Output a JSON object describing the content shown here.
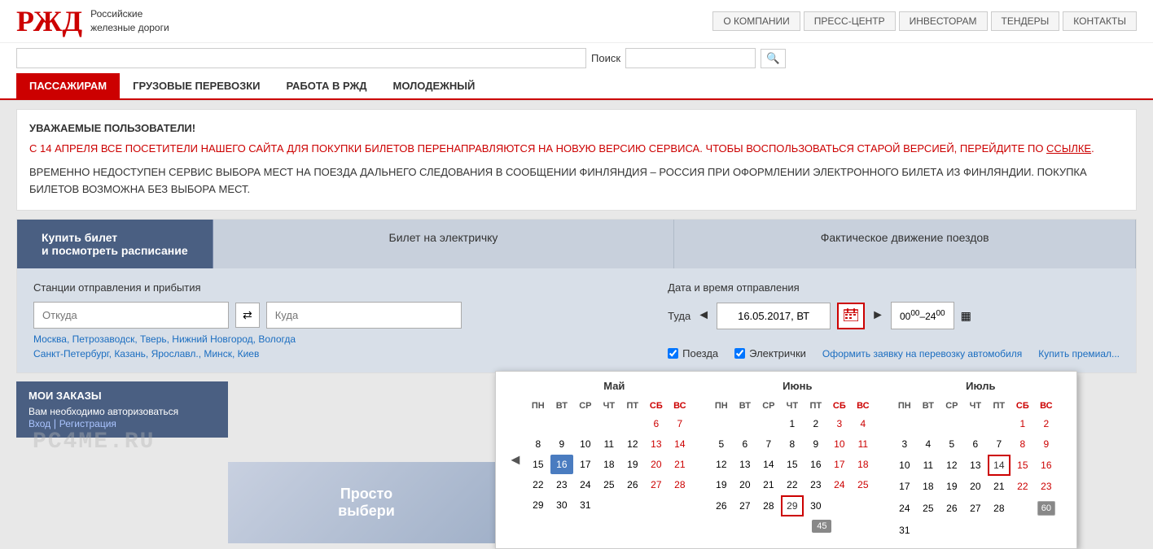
{
  "header": {
    "logo_text_line1": "Российские",
    "logo_text_line2": "железные дороги",
    "logo_symbol": "РЖД",
    "top_nav": [
      {
        "label": "О КОМПАНИИ"
      },
      {
        "label": "ПРЕСС-ЦЕНТР"
      },
      {
        "label": "ИНВЕСТОРАМ"
      },
      {
        "label": "ТЕНДЕРЫ"
      },
      {
        "label": "КОНТАКТЫ"
      }
    ],
    "search_label": "Поиск",
    "main_nav": [
      {
        "label": "ПАССАЖИРАМ",
        "active": true
      },
      {
        "label": "ГРУЗОВЫЕ ПЕРЕВОЗКИ",
        "active": false
      },
      {
        "label": "РАБОТА В РЖД",
        "active": false
      },
      {
        "label": "МОЛОДЕЖНЫЙ",
        "active": false
      }
    ]
  },
  "notice": {
    "title": "УВАЖАЕМЫЕ ПОЛЬЗОВАТЕЛИ!",
    "text1": "С 14 АПРЕЛЯ ВСЕ ПОСЕТИТЕЛИ НАШЕГО САЙТА ДЛЯ ПОКУПКИ БИЛЕТОВ ПЕРЕНАПРАВЛЯЮТСЯ НА НОВУЮ ВЕРСИЮ СЕРВИСА. ЧТОБЫ ВОСПОЛЬЗОВАТЬСЯ СТАРОЙ ВЕРСИЕЙ, ПЕРЕЙДИТЕ ПО ",
    "link": "ССЫЛКЕ",
    "text2": ".",
    "text3": "ВРЕМЕННО НЕДОСТУПЕН СЕРВИС ВЫБОРА МЕСТ НА ПОЕЗДА ДАЛЬНЕГО СЛЕДОВАНИЯ В СООБЩЕНИИ ФИНЛЯНДИЯ – РОССИЯ ПРИ ОФОРМЛЕНИИ ЭЛЕКТРОННОГО БИЛЕТА ИЗ ФИНЛЯНДИИ. ПОКУПКА БИЛЕТОВ ВОЗМОЖНА БЕЗ ВЫБОРА МЕСТ."
  },
  "tabs": [
    {
      "label": "Купить билет\nи посмотреть расписание",
      "active": true
    },
    {
      "label": "Билет на электричку",
      "active": false
    },
    {
      "label": "Фактическое движение поездов",
      "active": false
    }
  ],
  "form": {
    "stations_label": "Станции отправления и прибытия",
    "from_placeholder": "Откуда",
    "to_placeholder": "Куда",
    "from_suggestions": "Москва, Петрозаводск, Тверь, Нижний Новгород, Вологда",
    "to_suggestions": "Санкт-Петербург, Казань, Ярославл., Минск, Киев",
    "datetime_label": "Дата и время отправления",
    "direction_label": "Туда",
    "date_value": "16.05.2017, ВТ",
    "time_value": "00⁰⁰–24⁰⁰",
    "checkbox_train": "Поезда",
    "checkbox_elektr": "Электрички",
    "link1": "Оформить заявку на перевозку автомобиля",
    "link2": "Купить премиал..."
  },
  "my_orders": {
    "title": "МОИ ЗАКАЗЫ",
    "text": "Вам необходимо авторизоваться",
    "link_login": "Вход",
    "link_register": "Регистрация"
  },
  "calendar": {
    "months": [
      {
        "name": "Май",
        "headers": [
          "ПН",
          "ВТ",
          "СР",
          "ЧТ",
          "ПТ",
          "СБ",
          "ВС"
        ],
        "days": [
          {
            "d": "",
            "e": true
          },
          {
            "d": "",
            "e": true
          },
          {
            "d": "",
            "e": true
          },
          {
            "d": "",
            "e": true
          },
          {
            "d": "",
            "e": true
          },
          {
            "d": "6",
            "w": true
          },
          {
            "d": "7",
            "w": true
          },
          {
            "d": "8"
          },
          {
            "d": "9"
          },
          {
            "d": "10"
          },
          {
            "d": "11"
          },
          {
            "d": "12"
          },
          {
            "d": "13",
            "w": true
          },
          {
            "d": "14",
            "w": true
          },
          {
            "d": "15"
          },
          {
            "d": "16",
            "today": true
          },
          {
            "d": "17"
          },
          {
            "d": "18"
          },
          {
            "d": "19"
          },
          {
            "d": "20",
            "w": true
          },
          {
            "d": "21",
            "w": true
          },
          {
            "d": "22"
          },
          {
            "d": "23"
          },
          {
            "d": "24"
          },
          {
            "d": "25"
          },
          {
            "d": "26"
          },
          {
            "d": "27",
            "w": true
          },
          {
            "d": "28",
            "w": true
          },
          {
            "d": "29"
          },
          {
            "d": "30"
          },
          {
            "d": "31"
          },
          {
            "d": "",
            "e": true
          },
          {
            "d": "",
            "e": true
          },
          {
            "d": "",
            "e": true
          },
          {
            "d": "",
            "e": true
          }
        ]
      },
      {
        "name": "Июнь",
        "headers": [
          "ПН",
          "ВТ",
          "СР",
          "ЧТ",
          "ПТ",
          "СБ",
          "ВС"
        ],
        "days": [
          {
            "d": "",
            "e": true
          },
          {
            "d": "",
            "e": true
          },
          {
            "d": "",
            "e": true
          },
          {
            "d": "1"
          },
          {
            "d": "2"
          },
          {
            "d": "3",
            "w": true
          },
          {
            "d": "4",
            "w": true
          },
          {
            "d": "5"
          },
          {
            "d": "6"
          },
          {
            "d": "7"
          },
          {
            "d": "8"
          },
          {
            "d": "9"
          },
          {
            "d": "10",
            "w": true
          },
          {
            "d": "11",
            "w": true
          },
          {
            "d": "12"
          },
          {
            "d": "13"
          },
          {
            "d": "14"
          },
          {
            "d": "15"
          },
          {
            "d": "16"
          },
          {
            "d": "17",
            "w": true
          },
          {
            "d": "18",
            "w": true
          },
          {
            "d": "19"
          },
          {
            "d": "20"
          },
          {
            "d": "21"
          },
          {
            "d": "22"
          },
          {
            "d": "23"
          },
          {
            "d": "24",
            "w": true
          },
          {
            "d": "25",
            "w": true
          },
          {
            "d": "26"
          },
          {
            "d": "27"
          },
          {
            "d": "28"
          },
          {
            "d": "29",
            "sel": true
          },
          {
            "d": "30"
          },
          {
            "d": "",
            "e": true
          },
          {
            "d": "",
            "e": true
          }
        ]
      },
      {
        "name": "Июль",
        "headers": [
          "ПН",
          "ВТ",
          "СР",
          "ЧТ",
          "ПТ",
          "СБ",
          "ВС"
        ],
        "days": [
          {
            "d": "",
            "e": true
          },
          {
            "d": "",
            "e": true
          },
          {
            "d": "",
            "e": true
          },
          {
            "d": "",
            "e": true
          },
          {
            "d": "",
            "e": true
          },
          {
            "d": "1",
            "w": true
          },
          {
            "d": "2",
            "w": true
          },
          {
            "d": "3"
          },
          {
            "d": "4"
          },
          {
            "d": "5"
          },
          {
            "d": "6"
          },
          {
            "d": "7"
          },
          {
            "d": "8",
            "w": true
          },
          {
            "d": "9",
            "w": true
          },
          {
            "d": "10"
          },
          {
            "d": "11"
          },
          {
            "d": "12"
          },
          {
            "d": "13"
          },
          {
            "d": "14",
            "sel": true
          },
          {
            "d": "15",
            "w": true
          },
          {
            "d": "16",
            "w": true
          },
          {
            "d": "17"
          },
          {
            "d": "18"
          },
          {
            "d": "19"
          },
          {
            "d": "20"
          },
          {
            "d": "21"
          },
          {
            "d": "22",
            "w": true
          },
          {
            "d": "23",
            "w": true
          },
          {
            "d": "24"
          },
          {
            "d": "25"
          },
          {
            "d": "26"
          },
          {
            "d": "27"
          },
          {
            "d": "28"
          },
          {
            "d": "",
            "e": true
          },
          {
            "d": "60",
            "badge": true
          },
          {
            "d": "31"
          },
          {
            "d": "",
            "e": true
          },
          {
            "d": "",
            "e": true
          },
          {
            "d": "",
            "e": true
          },
          {
            "d": "",
            "e": true
          },
          {
            "d": "",
            "e": true
          },
          {
            "d": "",
            "e": true
          }
        ]
      }
    ],
    "badge_45": "45",
    "badge_60": "60"
  },
  "watermark": "PC4ME.RU",
  "promo_text": "Просто\nвыбери"
}
